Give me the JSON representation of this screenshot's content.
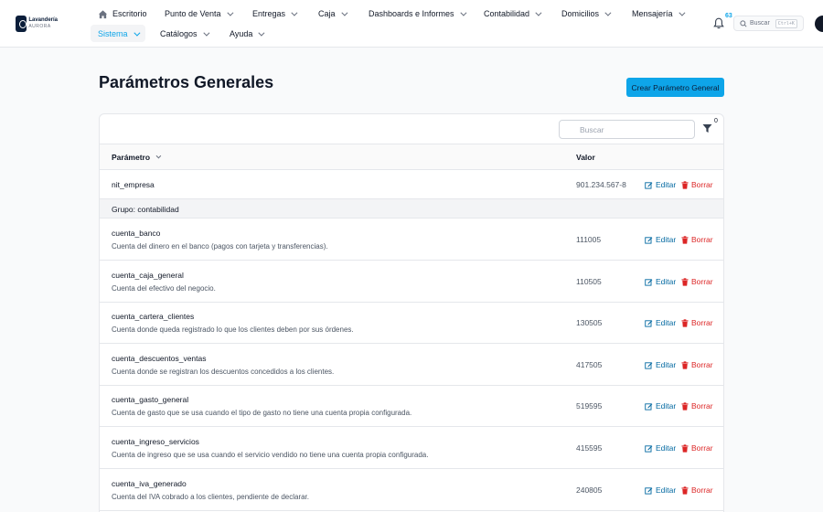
{
  "app": {
    "logo_line1": "Lavandería",
    "logo_line2": "AURORA"
  },
  "nav": {
    "items": [
      {
        "label": "Escritorio"
      },
      {
        "label": "Punto de Venta"
      },
      {
        "label": "Entregas"
      },
      {
        "label": "Caja"
      },
      {
        "label": "Dashboards e Informes"
      },
      {
        "label": "Contabilidad"
      },
      {
        "label": "Domicilios"
      },
      {
        "label": "Mensajería"
      },
      {
        "label": "Sistema"
      },
      {
        "label": "Catálogos"
      },
      {
        "label": "Ayuda"
      }
    ],
    "notification_count": "63",
    "search_label": "Buscar",
    "search_shortcut": "Ctrl+K"
  },
  "page": {
    "title": "Parámetros Generales",
    "create_label": "Crear Parámetro General"
  },
  "table": {
    "search_placeholder": "Buscar",
    "filter_count": "0",
    "columns": {
      "param": "Parámetro",
      "value": "Valor"
    },
    "edit_label": "Editar",
    "delete_label": "Borrar",
    "top_row": {
      "name": "nit_empresa",
      "value": "901.234.567-8"
    },
    "group_label": "Grupo: contabilidad",
    "rows": [
      {
        "name": "cuenta_banco",
        "desc": "Cuenta del dinero en el banco (pagos con tarjeta y transferencias).",
        "value": "111005"
      },
      {
        "name": "cuenta_caja_general",
        "desc": "Cuenta del efectivo del negocio.",
        "value": "110505"
      },
      {
        "name": "cuenta_cartera_clientes",
        "desc": "Cuenta donde queda registrado lo que los clientes deben por sus órdenes.",
        "value": "130505"
      },
      {
        "name": "cuenta_descuentos_ventas",
        "desc": "Cuenta donde se registran los descuentos concedidos a los clientes.",
        "value": "417505"
      },
      {
        "name": "cuenta_gasto_general",
        "desc": "Cuenta de gasto que se usa cuando el tipo de gasto no tiene una cuenta propia configurada.",
        "value": "519595"
      },
      {
        "name": "cuenta_ingreso_servicios",
        "desc": "Cuenta de ingreso que se usa cuando el servicio vendido no tiene una cuenta propia configurada.",
        "value": "415595"
      },
      {
        "name": "cuenta_iva_generado",
        "desc": "Cuenta del IVA cobrado a los clientes, pendiente de declarar.",
        "value": "240805"
      }
    ]
  },
  "colors": {
    "accent": "#0ea5e9",
    "edit": "#0369a1",
    "delete": "#dc2626"
  }
}
